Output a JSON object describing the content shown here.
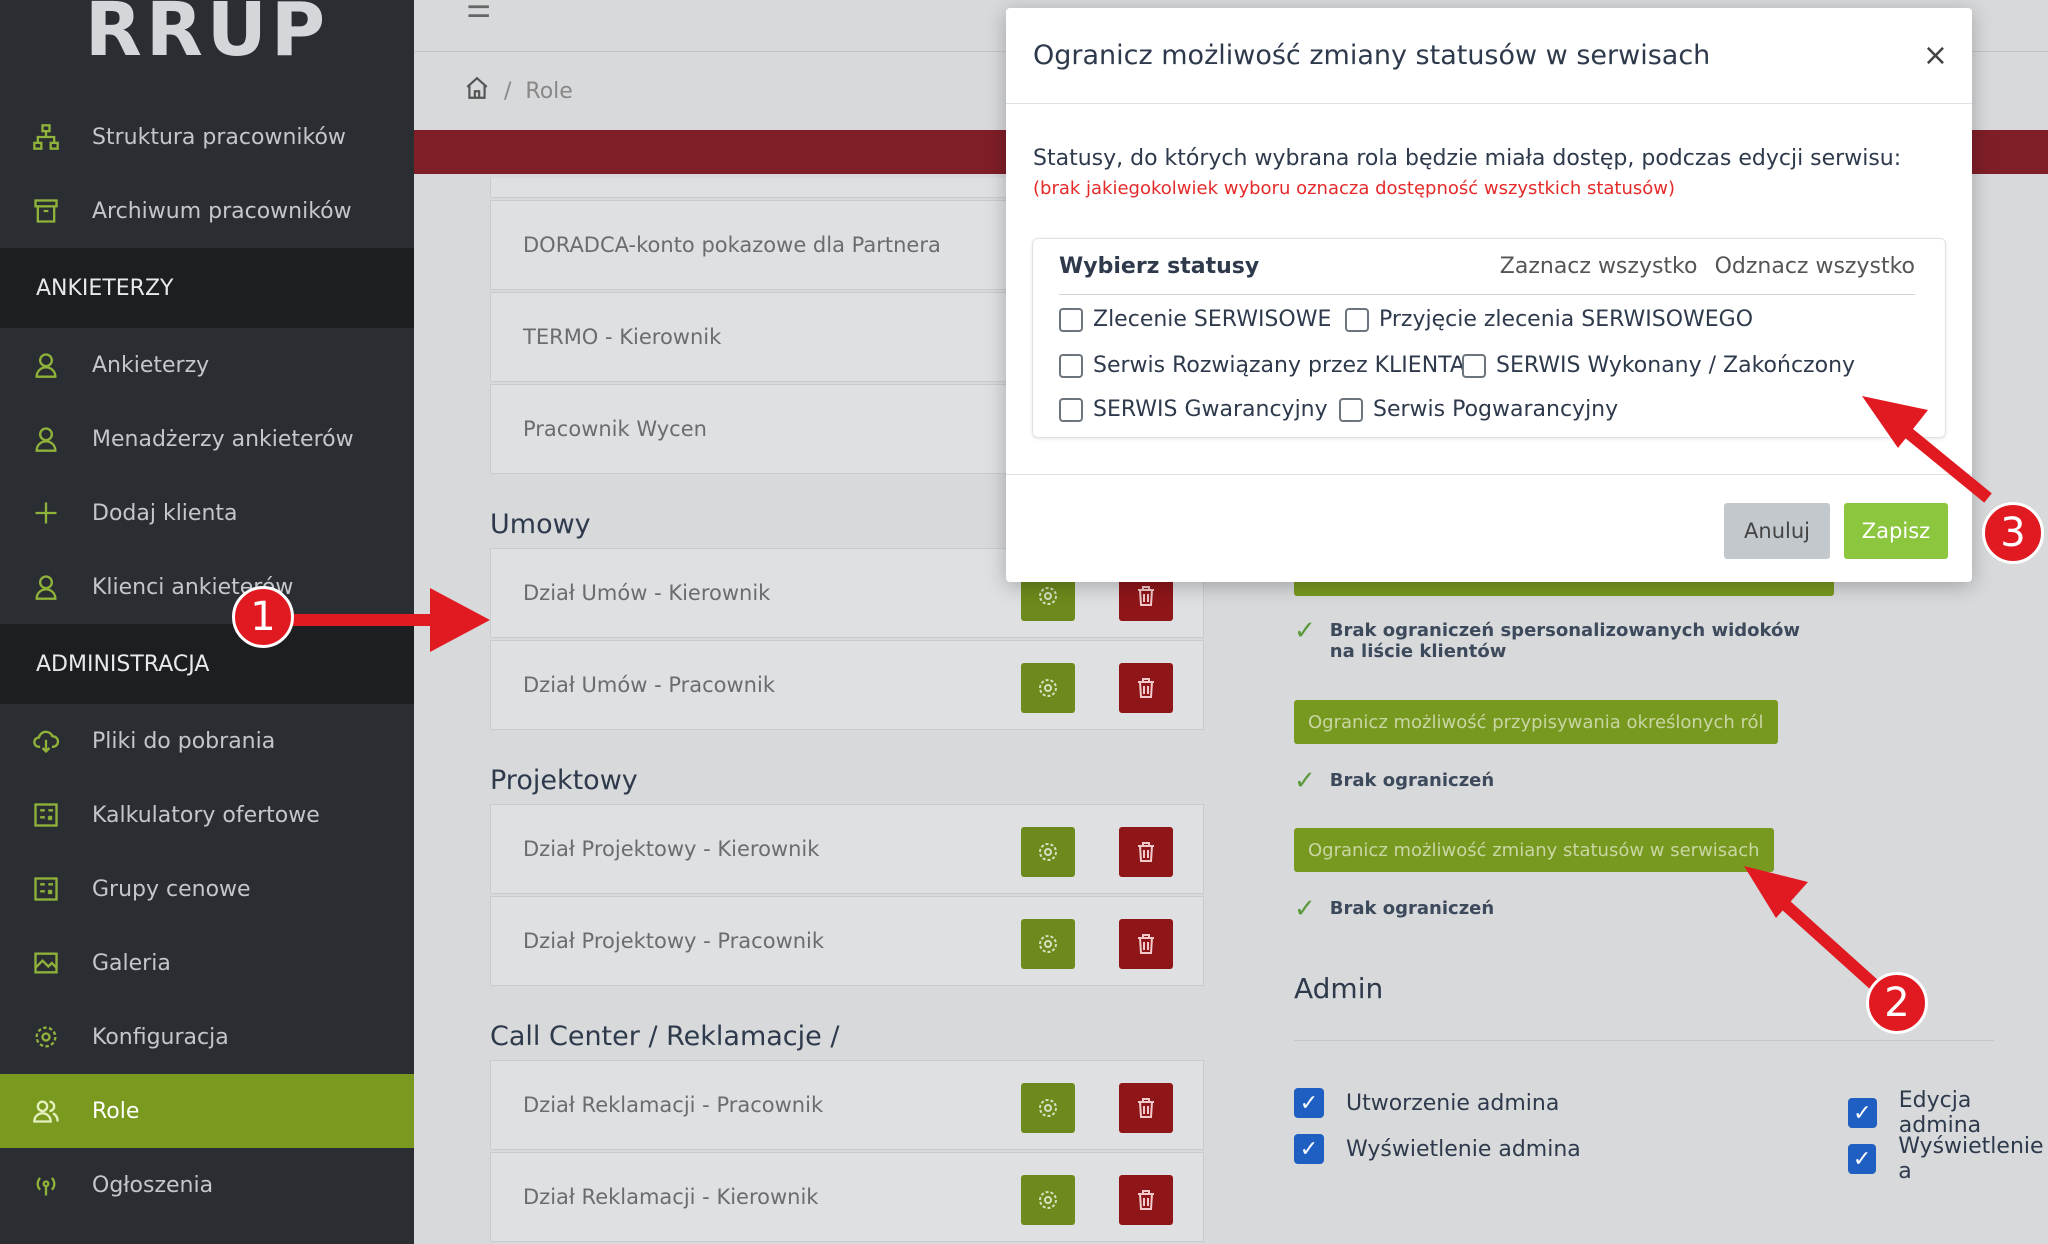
{
  "logo": "RRUP",
  "sidebar": {
    "items_top": [
      {
        "label": "Struktura pracowników",
        "icon": "org-chart-icon"
      },
      {
        "label": "Archiwum pracowników",
        "icon": "archive-icon"
      }
    ],
    "section_ankieterzy": "ANKIETERZY",
    "items_ankieterzy": [
      {
        "label": "Ankieterzy",
        "icon": "user-icon"
      },
      {
        "label": "Menadżerzy ankieterów",
        "icon": "user-icon"
      },
      {
        "label": "Dodaj klienta",
        "icon": "plus-icon"
      },
      {
        "label": "Klienci ankieterów",
        "icon": "user-icon"
      }
    ],
    "section_admin": "ADMINISTRACJA",
    "items_admin": [
      {
        "label": "Pliki do pobrania",
        "icon": "cloud-download-icon"
      },
      {
        "label": "Kalkulatory ofertowe",
        "icon": "calculator-icon"
      },
      {
        "label": "Grupy cenowe",
        "icon": "calculator-icon"
      },
      {
        "label": "Galeria",
        "icon": "gallery-icon"
      },
      {
        "label": "Konfiguracja",
        "icon": "gear-icon"
      },
      {
        "label": "Role",
        "icon": "users-icon",
        "active": true
      },
      {
        "label": "Ogłoszenia",
        "icon": "broadcast-icon"
      }
    ]
  },
  "breadcrumb": {
    "current": "Role",
    "separator": "/"
  },
  "roles": {
    "pre": [
      "DORADCA-konto pokazowe dla Partnera",
      "TERMO - Kierownik",
      "Pracownik Wycen"
    ],
    "groups": [
      {
        "title": "Umowy",
        "items": [
          "Dział Umów - Kierownik",
          "Dział Umów - Pracownik"
        ]
      },
      {
        "title": "Projektowy",
        "items": [
          "Dział Projektowy - Kierownik",
          "Dział Projektowy - Pracownik"
        ]
      },
      {
        "title": "Call Center / Reklamacje /",
        "items": [
          "Dział Reklamacji - Pracownik",
          "Dział Reklamacji - Kierownik"
        ]
      }
    ]
  },
  "right": {
    "no_limits_views": "Brak ograniczeń spersonalizowanych widoków na liście klientów",
    "btn_roles": "Ogranicz możliwość przypisywania określonych ról",
    "no_limits_1": "Brak ograniczeń",
    "btn_statuses": "Ogranicz możliwość zmiany statusów w serwisach",
    "no_limits_2": "Brak ograniczeń",
    "admin_title": "Admin",
    "admin_checks": [
      "Utworzenie admina",
      "Wyświetlenie admina",
      "Edycja admina",
      "Wyświetlenie a"
    ]
  },
  "modal": {
    "title": "Ogranicz możliwość zmiany statusów w serwisach",
    "close": "×",
    "description": "Statusy, do których wybrana rola będzie miała dostęp, podczas edycji serwisu:",
    "note": "(brak jakiegokolwiek wyboru oznacza dostępność wszystkich statusów)",
    "box_title": "Wybierz statusy",
    "select_all": "Zaznacz wszystko",
    "deselect_all": "Odznacz wszystko",
    "options": [
      "Zlecenie SERWISOWE",
      "Przyjęcie zlecenia SERWISOWEGO",
      "Serwis Rozwiązany przez KLIENTA",
      "SERWIS Wykonany / Zakończony",
      "SERWIS Gwarancyjny",
      "Serwis Pogwarancyjny"
    ],
    "cancel": "Anuluj",
    "save": "Zapisz"
  },
  "annotations": [
    "1",
    "2",
    "3"
  ],
  "colors": {
    "accent_green": "#8cc63f",
    "annotation_red": "#e11a22",
    "sidebar_bg": "#2a2d32"
  }
}
